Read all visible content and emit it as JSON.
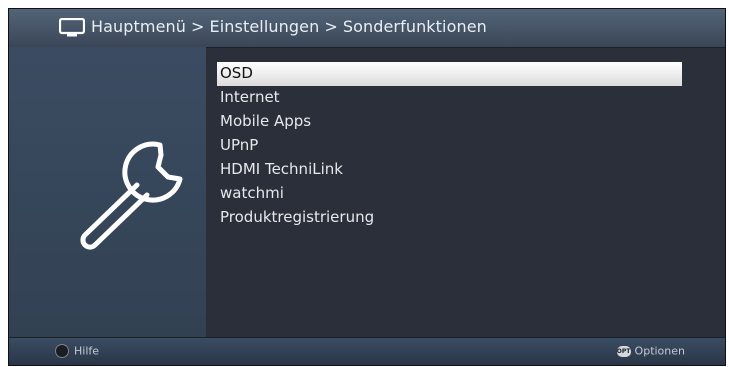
{
  "header": {
    "breadcrumb": [
      "Hauptmenü",
      "Einstellungen",
      "Sonderfunktionen"
    ],
    "separator": ">",
    "icon": "tv-icon"
  },
  "left_panel": {
    "icon": "wrench-icon"
  },
  "menu": {
    "items": [
      {
        "label": "OSD",
        "selected": true
      },
      {
        "label": "Internet",
        "selected": false
      },
      {
        "label": "Mobile Apps",
        "selected": false
      },
      {
        "label": "UPnP",
        "selected": false
      },
      {
        "label": "HDMI TechniLink",
        "selected": false
      },
      {
        "label": "watchmi",
        "selected": false
      },
      {
        "label": "Produktregistrierung",
        "selected": false
      }
    ]
  },
  "footer": {
    "help_label": "Hilfe",
    "options_icon_text": "OPT",
    "options_label": "Optionen"
  },
  "colors": {
    "background": "#2b2f3a",
    "header": "#4a5a6e",
    "left_panel": "#3b4c62",
    "selection": "#ffffff",
    "text": "#e6e8ec"
  }
}
